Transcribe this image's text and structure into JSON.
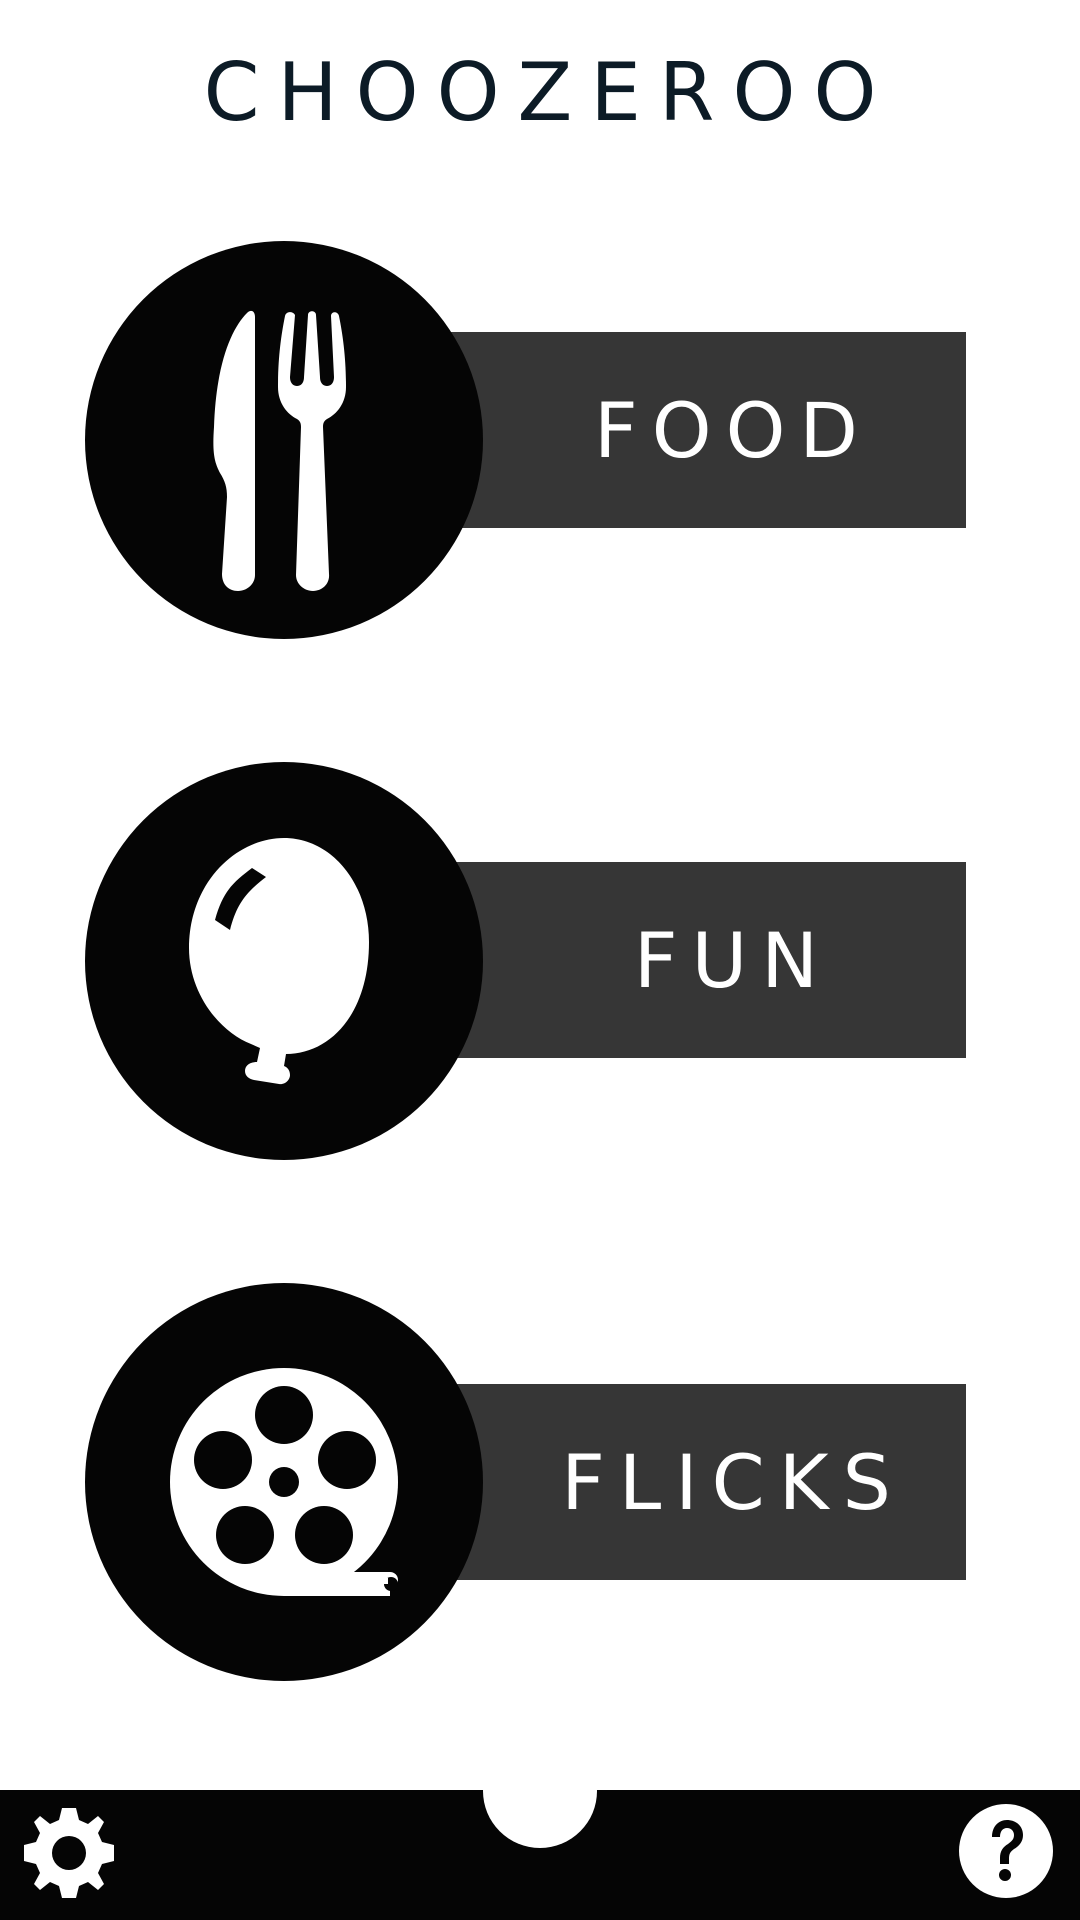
{
  "app": {
    "title": "CHOOZEROO"
  },
  "categories": [
    {
      "label": "FOOD",
      "icon": "fork-knife-icon"
    },
    {
      "label": "FUN",
      "icon": "balloon-icon"
    },
    {
      "label": "FLICKS",
      "icon": "film-reel-icon"
    }
  ],
  "bottom_bar": {
    "left_icon": "gear-icon",
    "center_icon": "home-tab",
    "right_icon": "question-mark-icon"
  },
  "colors": {
    "background": "#ffffff",
    "title_text": "#0c1b26",
    "circle": "#050505",
    "bar": "#363636",
    "label_text": "#ffffff",
    "bottom_bar": "#050505"
  }
}
